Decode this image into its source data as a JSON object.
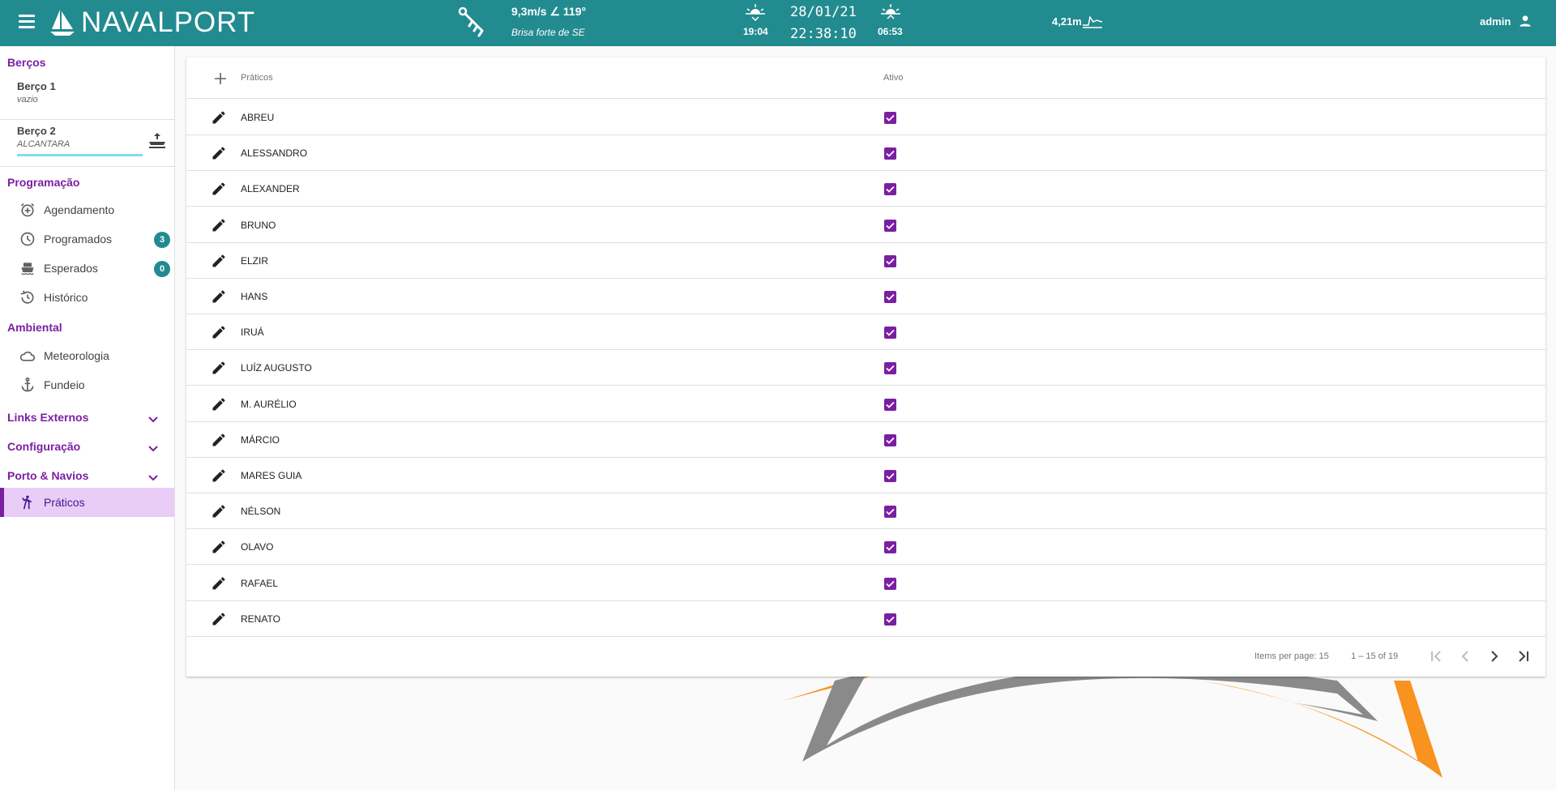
{
  "header": {
    "app_name": "NAVALPORT",
    "wind_speed": "9,3m/s ∠ 119°",
    "wind_description": "Brisa forte de SE",
    "sunset_time": "19:04",
    "date": "28/01/21",
    "time": "22:38:10",
    "sunrise_time": "06:53",
    "tide_level": "4,21m",
    "user_name": "admin"
  },
  "sidebar": {
    "berths_title": "Berços",
    "berths": [
      {
        "name": "Berço 1",
        "status": "vazio"
      },
      {
        "name": "Berço 2",
        "status": "ALCANTARA"
      }
    ],
    "programacao_title": "Programação",
    "programacao_items": [
      {
        "label": "Agendamento",
        "icon": "alarm-add-icon"
      },
      {
        "label": "Programados",
        "icon": "clock-icon",
        "badge": "3"
      },
      {
        "label": "Esperados",
        "icon": "ship-icon",
        "badge": "0"
      },
      {
        "label": "Histórico",
        "icon": "history-icon"
      }
    ],
    "ambiental_title": "Ambiental",
    "ambiental_items": [
      {
        "label": "Meteorologia",
        "icon": "cloud-icon"
      },
      {
        "label": "Fundeio",
        "icon": "anchor-icon"
      }
    ],
    "expandables": [
      {
        "label": "Links Externos"
      },
      {
        "label": "Configuração"
      },
      {
        "label": "Porto & Navios"
      }
    ],
    "active_item": {
      "label": "Práticos",
      "icon": "pilot-icon"
    }
  },
  "table": {
    "col_name": "Práticos",
    "col_active": "Ativo",
    "rows": [
      {
        "name": "ABREU",
        "active": true
      },
      {
        "name": "ALESSANDRO",
        "active": true
      },
      {
        "name": "ALEXANDER",
        "active": true
      },
      {
        "name": "BRUNO",
        "active": true
      },
      {
        "name": "ELZIR",
        "active": true
      },
      {
        "name": "HANS",
        "active": true
      },
      {
        "name": "IRUÁ",
        "active": true
      },
      {
        "name": "LUÍZ AUGUSTO",
        "active": true
      },
      {
        "name": "M. AURÉLIO",
        "active": true
      },
      {
        "name": "MÁRCIO",
        "active": true
      },
      {
        "name": "MARES GUIA",
        "active": true
      },
      {
        "name": "NÉLSON",
        "active": true
      },
      {
        "name": "OLAVO",
        "active": true
      },
      {
        "name": "RAFAEL",
        "active": true
      },
      {
        "name": "RENATO",
        "active": true
      }
    ]
  },
  "paginator": {
    "items_per_page_label": "Items per page:",
    "items_per_page": "15",
    "range": "1 – 15 of 19"
  },
  "colors": {
    "header_bg": "#228b8f",
    "accent_purple": "#7b1fa2",
    "active_bg": "#e9cdf6"
  }
}
